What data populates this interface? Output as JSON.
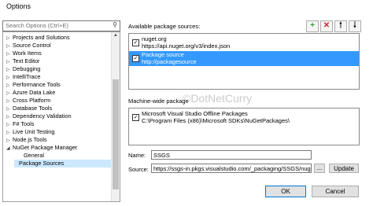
{
  "window": {
    "title": "Options"
  },
  "search": {
    "placeholder": "Search Options (Ctrl+E)"
  },
  "tree": {
    "items": [
      {
        "label": "Projects and Solutions"
      },
      {
        "label": "Source Control"
      },
      {
        "label": "Work Items"
      },
      {
        "label": "Text Editor"
      },
      {
        "label": "Debugging"
      },
      {
        "label": "IntelliTrace"
      },
      {
        "label": "Performance Tools"
      },
      {
        "label": "Azure Data Lake"
      },
      {
        "label": "Cross Platform"
      },
      {
        "label": "Database Tools"
      },
      {
        "label": "Dependency Validation"
      },
      {
        "label": "F# Tools"
      },
      {
        "label": "Live Unit Testing"
      },
      {
        "label": "Node.js Tools"
      },
      {
        "label": "NuGet Package Manager"
      }
    ],
    "children": [
      {
        "label": "General"
      },
      {
        "label": "Package Sources"
      }
    ]
  },
  "sources": {
    "heading": "Available package sources:",
    "toolbar": {
      "add_icon": "plus-icon",
      "remove_icon": "x-icon",
      "up_icon": "arrow-up-icon",
      "down_icon": "arrow-down-icon"
    },
    "items": [
      {
        "name": "nuget.org",
        "url": "https://api.nuget.org/v3/index.json",
        "checked": true,
        "selected": false
      },
      {
        "name": "Package source",
        "url": "http://packagesource",
        "checked": true,
        "selected": true
      }
    ]
  },
  "machine": {
    "heading": "Machine-wide package",
    "items": [
      {
        "name": "Microsoft Visual Studio Offline Packages",
        "path": "C:\\Program Files (x86)\\Microsoft SDKs\\NuGetPackages\\",
        "checked": true
      }
    ]
  },
  "form": {
    "name_label": "Name:",
    "name_value": "SSGS",
    "source_label": "Source:",
    "source_value": "https://ssgs-in.pkgs.visualstudio.com/_packaging/SSGS/nuget/",
    "browse_label": "...",
    "update_label": "Update"
  },
  "buttons": {
    "ok": "OK",
    "cancel": "Cancel"
  },
  "watermark": "©DotNetCurry",
  "colors": {
    "selection": "#3399ff",
    "add_green": "#2e9b2e",
    "remove_red": "#cc2222"
  }
}
